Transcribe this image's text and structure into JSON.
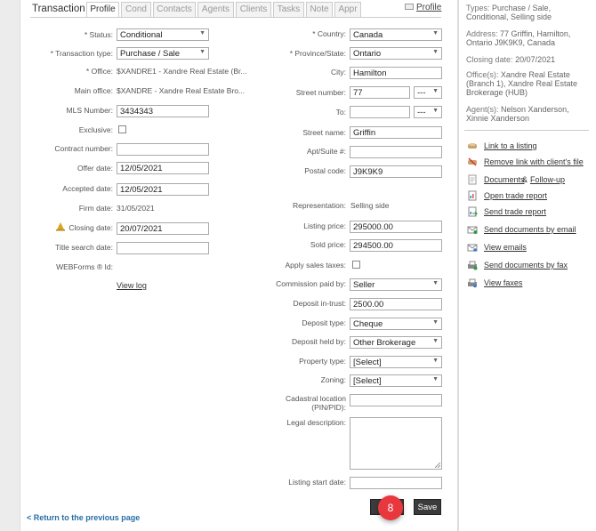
{
  "tabs": {
    "title": "Transaction",
    "items": [
      "Profile",
      "Cond",
      "Contacts",
      "Agents",
      "Clients",
      "Tasks",
      "Note",
      "Appr"
    ],
    "profile_link": "Profile"
  },
  "left": {
    "status_label": "* Status:",
    "status_value": "Conditional",
    "ttype_label": "* Transaction type:",
    "ttype_value": "Purchase / Sale",
    "office_label": "* Office:",
    "office_value": "$XANDRE1 - Xandre Real Estate (Br...",
    "main_office_label": "Main office:",
    "main_office_value": "$XANDRE - Xandre Real Estate Bro...",
    "mls_label": "MLS Number:",
    "mls_value": "3434343",
    "exclusive_label": "Exclusive:",
    "contract_label": "Contract number:",
    "contract_value": "",
    "offer_label": "Offer date:",
    "offer_value": "12/05/2021",
    "accepted_label": "Accepted date:",
    "accepted_value": "12/05/2021",
    "firm_label": "Firm date:",
    "firm_value": "31/05/2021",
    "closing_label": "Closing date:",
    "closing_value": "20/07/2021",
    "title_search_label": "Title search date:",
    "title_search_value": "",
    "webforms_label": "WEBForms ® Id:",
    "view_log": "View log"
  },
  "right": {
    "country_label": "* Country:",
    "country_value": "Canada",
    "province_label": "* Province/State:",
    "province_value": "Ontario",
    "city_label": "City:",
    "city_value": "Hamilton",
    "street_number_label": "Street number:",
    "street_number_value": "77",
    "street_number_suffix": "---",
    "to_label": "To:",
    "to_value": "",
    "to_suffix": "---",
    "street_name_label": "Street name:",
    "street_name_value": "Griffin",
    "apt_label": "Apt/Suite #:",
    "apt_value": "",
    "postal_label": "Postal code:",
    "postal_value": "J9K9K9",
    "representation_label": "Representation:",
    "representation_value": "Selling side",
    "listing_price_label": "Listing price:",
    "listing_price_value": "295000.00",
    "sold_price_label": "Sold price:",
    "sold_price_value": "294500.00",
    "apply_tax_label": "Apply sales taxes:",
    "commission_label": "Commission paid by:",
    "commission_value": "Seller",
    "deposit_trust_label": "Deposit in-trust:",
    "deposit_trust_value": "2500.00",
    "deposit_type_label": "Deposit type:",
    "deposit_type_value": "Cheque",
    "deposit_held_label": "Deposit held by:",
    "deposit_held_value": "Other Brokerage",
    "property_type_label": "Property type:",
    "property_type_value": "[Select]",
    "zoning_label": "Zoning:",
    "zoning_value": "[Select]",
    "cadastral_label_1": "Cadastral location",
    "cadastral_label_2": "(PIN/PID):",
    "legal_label": "Legal description:",
    "listing_start_label": "Listing start date:",
    "listing_start_value": ""
  },
  "footer": {
    "back_link": "< Return to the previous page",
    "save_label": "Save",
    "badge": "8"
  },
  "sidebar": {
    "types_label": "Types:",
    "types_value": "Purchase / Sale, Conditional, Selling side",
    "address_label": "Address:",
    "address_value": "77 Griffin, Hamilton, Ontario J9K9K9, Canada",
    "closing_label": "Closing date:",
    "closing_value": "20/07/2021",
    "offices_label": "Office(s):",
    "offices_value": "Xandre Real Estate (Branch 1), Xandre Real Estate Brokerage (HUB)",
    "agents_label": "Agent(s):",
    "agents_value": "Nelson Xanderson, Xinnie Xanderson",
    "actions": {
      "link_listing": "Link to a listing",
      "remove_link": "Remove link with client's file",
      "documents": "Documents",
      "and": "&",
      "followup": "Follow-up",
      "open_trade": "Open trade report",
      "send_trade": "Send trade report",
      "send_docs_email": "Send documents by email",
      "view_emails": "View emails",
      "send_docs_fax": "Send documents by fax",
      "view_faxes": "View faxes"
    }
  },
  "colors": {
    "accent_link": "#2a6ea6",
    "badge": "#e8383d",
    "button": "#3b3b3b"
  }
}
